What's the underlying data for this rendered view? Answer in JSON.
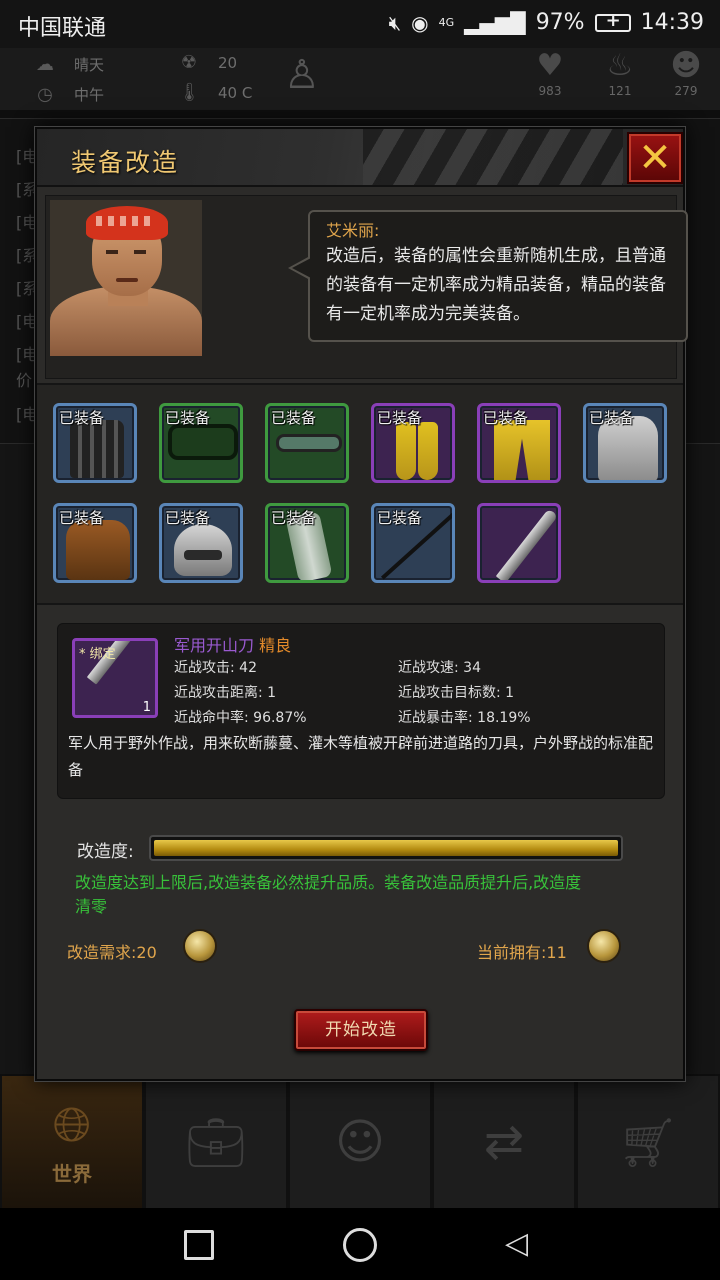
{
  "status_bar": {
    "carrier": "中国联通",
    "network": "4G",
    "battery": "97%",
    "time": "14:39"
  },
  "hud": {
    "weather": "晴天",
    "time_of_day": "中午",
    "radiation": "20",
    "temperature": "40 C",
    "health": "983",
    "hunger": "121",
    "mind": "279"
  },
  "bg_log": [
    "[电",
    "[系",
    "[电",
    "[系",
    "[系",
    "[电",
    "[电",
    "价",
    "[电"
  ],
  "modal": {
    "title": "装备改造",
    "close_label": "✕",
    "npc": {
      "speaker": "艾米丽:",
      "speech": "改造后，装备的属性会重新随机生成，且普通的装备有一定机率成为精品装备，精品的装备有一定机率成为完美装备。"
    },
    "equipped_tag": "已装备",
    "slots": [
      {
        "rarity": "blue",
        "icon": "tactical-vest",
        "equipped": true
      },
      {
        "rarity": "green",
        "icon": "goggles",
        "equipped": true
      },
      {
        "rarity": "green",
        "icon": "glasses",
        "equipped": true
      },
      {
        "rarity": "purple",
        "icon": "yellow-socks",
        "equipped": true
      },
      {
        "rarity": "purple",
        "icon": "yellow-pants",
        "equipped": true
      },
      {
        "rarity": "blue",
        "icon": "bare-torso",
        "equipped": true
      },
      {
        "rarity": "blue",
        "icon": "leather-jacket",
        "equipped": true
      },
      {
        "rarity": "blue",
        "icon": "helmet",
        "equipped": true
      },
      {
        "rarity": "green",
        "icon": "arm-guard",
        "equipped": true
      },
      {
        "rarity": "blue",
        "icon": "spear",
        "equipped": true
      },
      {
        "rarity": "purple",
        "icon": "machete",
        "equipped": false
      }
    ],
    "item": {
      "bound_tag": "* 绑定",
      "quantity": "1",
      "name": "军用开山刀",
      "quality": "精良",
      "stats_left": [
        "近战攻击: 42",
        "近战攻击距离: 1",
        "近战命中率: 96.87%"
      ],
      "stats_right": [
        "近战攻速: 34",
        "近战攻击目标数: 1",
        "近战暴击率: 18.19%"
      ],
      "description": "军人用于野外作战，用来砍断藤蔓、灌木等植被开辟前进道路的刀具，户外野战的标准配备"
    },
    "progress": {
      "label": "改造度:",
      "value": 1.0
    },
    "hint": "改造度达到上限后,改造装备必然提升品质。装备改造品质提升后,改造度清零",
    "requirement": "改造需求:20",
    "owned": "当前拥有:11",
    "start_button": "开始改造"
  },
  "game_nav": {
    "tabs": [
      {
        "label": "世界",
        "icon": "globe-icon",
        "active": true
      },
      {
        "label": "",
        "icon": "backpack-icon",
        "active": false
      },
      {
        "label": "",
        "icon": "skills-head-icon",
        "active": false
      },
      {
        "label": "",
        "icon": "trade-icon",
        "active": false
      },
      {
        "label": "",
        "icon": "cart-icon",
        "active": false
      }
    ]
  }
}
